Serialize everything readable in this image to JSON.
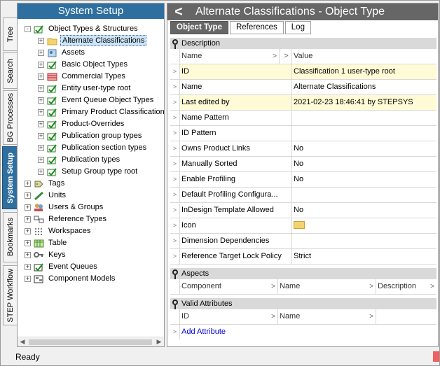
{
  "left_tabs": [
    "Tree",
    "Search",
    "BG Processes",
    "System Setup",
    "Bookmarks",
    "STEP Workflow"
  ],
  "left_panel": {
    "title": "System Setup",
    "tree": [
      {
        "label": "Object Types & Structures",
        "icon": "object-types-icon",
        "expander": "-",
        "selected": false
      },
      {
        "label": "Alternate Classifications",
        "icon": "folder-icon",
        "expander": "+",
        "selected": true
      },
      {
        "label": "Assets",
        "icon": "assets-icon",
        "expander": "+",
        "selected": false
      },
      {
        "label": "Basic Object Types",
        "icon": "object-type-icon",
        "expander": "+",
        "selected": false
      },
      {
        "label": "Commercial Types",
        "icon": "commercial-types-icon",
        "expander": "+",
        "selected": false
      },
      {
        "label": "Entity user-type root",
        "icon": "object-type-icon",
        "expander": "+",
        "selected": false
      },
      {
        "label": "Event Queue Object Types",
        "icon": "object-type-icon",
        "expander": "+",
        "selected": false
      },
      {
        "label": "Primary Product Classification",
        "icon": "object-type-icon",
        "expander": "+",
        "selected": false
      },
      {
        "label": "Product-Overrides",
        "icon": "object-type-icon",
        "expander": "+",
        "selected": false
      },
      {
        "label": "Publication group types",
        "icon": "object-type-icon",
        "expander": "+",
        "selected": false
      },
      {
        "label": "Publication section types",
        "icon": "object-type-icon",
        "expander": "+",
        "selected": false
      },
      {
        "label": "Publication types",
        "icon": "object-type-icon",
        "expander": "+",
        "selected": false
      },
      {
        "label": "Setup Group type root",
        "icon": "object-type-icon",
        "expander": "+",
        "selected": false
      },
      {
        "label": "Tags",
        "icon": "tags-icon",
        "expander": "+",
        "selected": false
      },
      {
        "label": "Units",
        "icon": "units-icon",
        "expander": "+",
        "selected": false
      },
      {
        "label": "Users & Groups",
        "icon": "users-icon",
        "expander": "+",
        "selected": false
      },
      {
        "label": "Reference Types",
        "icon": "reference-types-icon",
        "expander": "+",
        "selected": false
      },
      {
        "label": "Workspaces",
        "icon": "workspaces-icon",
        "expander": "+",
        "selected": false
      },
      {
        "label": "Table",
        "icon": "table-icon",
        "expander": "+",
        "selected": false
      },
      {
        "label": "Keys",
        "icon": "keys-icon",
        "expander": "+",
        "selected": false
      },
      {
        "label": "Event Queues",
        "icon": "event-queues-icon",
        "expander": "+",
        "selected": false
      },
      {
        "label": "Component Models",
        "icon": "component-models-icon",
        "expander": "+",
        "selected": false
      }
    ]
  },
  "right_panel": {
    "title": "Alternate Classifications - Object Type",
    "back_glyph": "<",
    "tabs": [
      "Object Type",
      "References",
      "Log"
    ],
    "description": {
      "title": "Description",
      "col_name": "Name",
      "col_value": "Value",
      "rows": [
        {
          "name": "ID",
          "value": "Classification 1 user-type root",
          "highlight": true
        },
        {
          "name": "Name",
          "value": "Alternate Classifications",
          "highlight": false
        },
        {
          "name": "Last edited by",
          "value": "2021-02-23 18:46:41 by STEPSYS",
          "highlight": true
        },
        {
          "name": "Name Pattern",
          "value": "",
          "highlight": false
        },
        {
          "name": "ID Pattern",
          "value": "",
          "highlight": false
        },
        {
          "name": "Owns Product Links",
          "value": "No",
          "highlight": false
        },
        {
          "name": "Manually Sorted",
          "value": "No",
          "highlight": false
        },
        {
          "name": "Enable Profiling",
          "value": "No",
          "highlight": false
        },
        {
          "name": "Default Profiling Configura...",
          "value": "",
          "highlight": false
        },
        {
          "name": "InDesign Template Allowed",
          "value": "No",
          "highlight": false
        },
        {
          "name": "Icon",
          "value": "",
          "highlight": false
        },
        {
          "name": "Dimension Dependencies",
          "value": "",
          "highlight": false
        },
        {
          "name": "Reference Target Lock Policy",
          "value": "Strict",
          "highlight": false
        }
      ]
    },
    "aspects": {
      "title": "Aspects",
      "columns": [
        "Component",
        "Name",
        "Description"
      ]
    },
    "valid_attributes": {
      "title": "Valid Attributes",
      "columns": [
        "ID",
        "Name"
      ],
      "add_label": "Add Attribute"
    }
  },
  "status": {
    "text": "Ready"
  },
  "colors": {
    "accent": "#2f6f9f",
    "header_gray": "#666666",
    "highlight": "#fffbd6",
    "status_indicator": "#f06060"
  }
}
